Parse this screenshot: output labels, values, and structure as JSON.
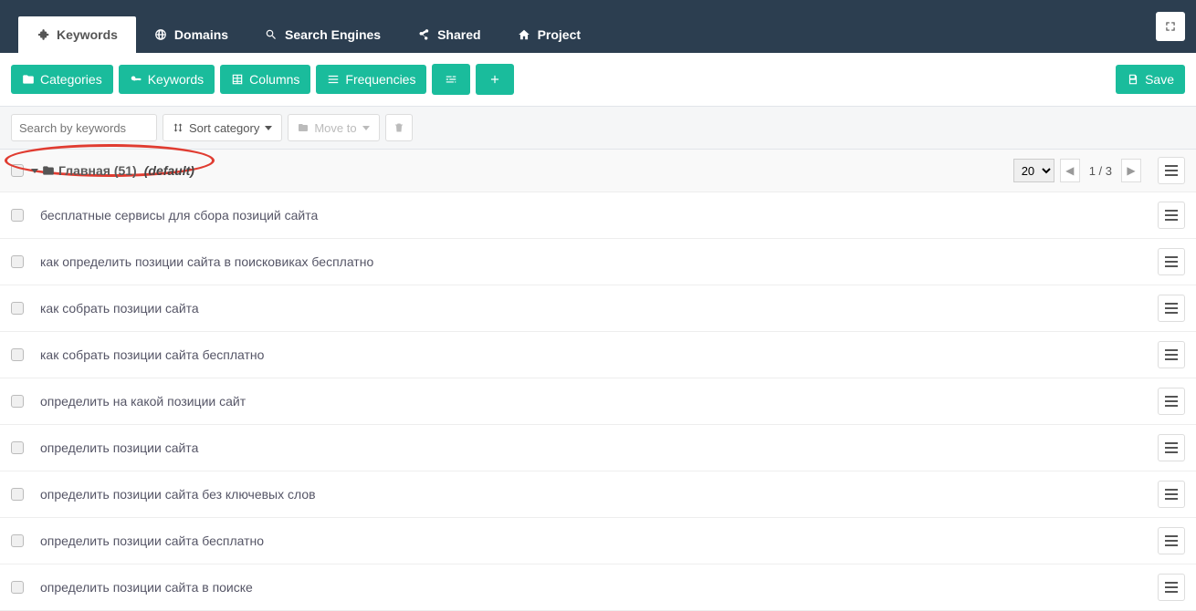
{
  "nav": {
    "tabs": [
      {
        "label": "Keywords",
        "icon": "keys"
      },
      {
        "label": "Domains",
        "icon": "globe"
      },
      {
        "label": "Search Engines",
        "icon": "search"
      },
      {
        "label": "Shared",
        "icon": "share"
      },
      {
        "label": "Project",
        "icon": "home"
      }
    ]
  },
  "toolbar": {
    "categories": "Categories",
    "keywords": "Keywords",
    "columns": "Columns",
    "frequencies": "Frequencies",
    "save": "Save"
  },
  "subtoolbar": {
    "search_placeholder": "Search by keywords",
    "sort": "Sort category",
    "move": "Move to"
  },
  "category": {
    "name": "Главная (51)",
    "default_label": "(default)",
    "page_size": "20",
    "pager": "1 / 3"
  },
  "keywords": [
    "бесплатные сервисы для сбора позиций сайта",
    "как определить позиции сайта в поисковиках бесплатно",
    "как собрать позиции сайта",
    "как собрать позиции сайта бесплатно",
    "определить на какой позиции сайт",
    "определить позиции сайта",
    "определить позиции сайта без ключевых слов",
    "определить позиции сайта бесплатно",
    "определить позиции сайта в поиске"
  ]
}
